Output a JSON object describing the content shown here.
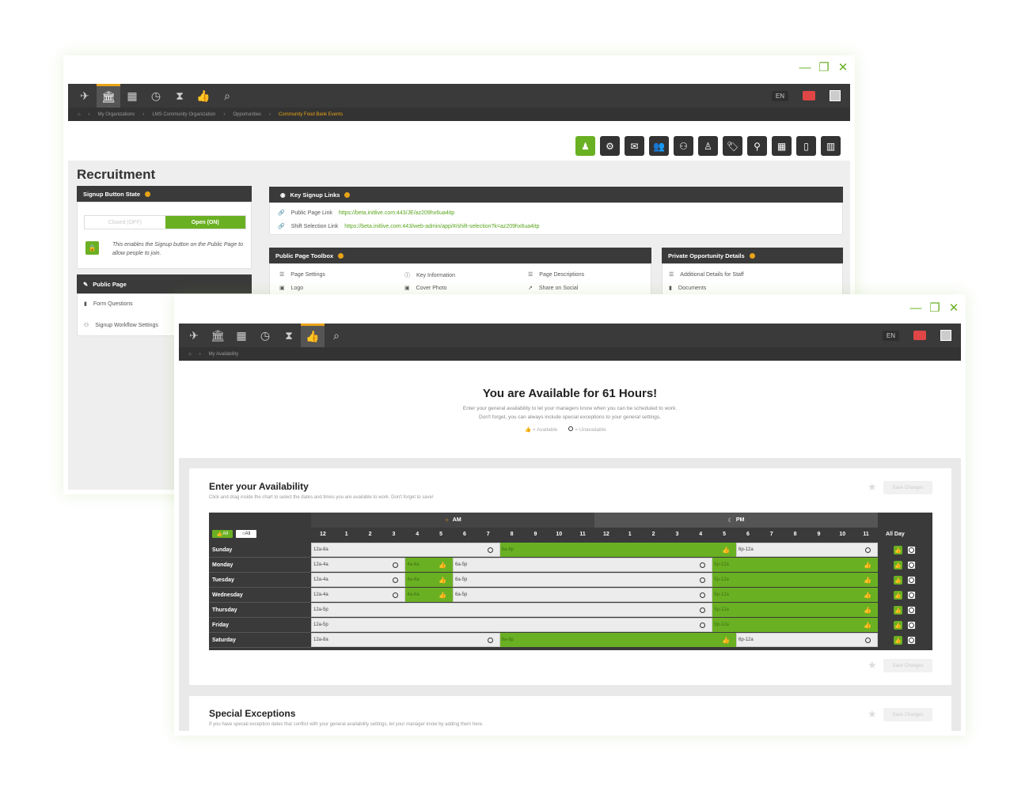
{
  "window1": {
    "page_title": "Recruitment",
    "lang": "EN",
    "breadcrumbs": [
      "My Organizations",
      "LMS Community Organization",
      "Opportunities",
      "Community Food Bank Events"
    ],
    "signup_state": {
      "title": "Signup Button State",
      "closed_label": "Closed (OFF)",
      "open_label": "Open (ON)",
      "description": "This enables the Signup button on the Public Page to allow people to join."
    },
    "key_links": {
      "title": "Key Signup Links",
      "public_label": "Public Page Link",
      "public_url": "https://beta.initlive.com:443/JE/az209hx6ua4itp",
      "shift_label": "Shift Selection Link",
      "shift_url": "https://beta.initlive.com:443/web-admin/app/#/shift-selection?k=az209hx6ua4itp"
    },
    "toolbox": {
      "title": "Public Page Toolbox",
      "items": [
        "Page Settings",
        "Key Information",
        "Page Descriptions",
        "Logo",
        "Cover Photo",
        "Share on Social"
      ]
    },
    "private": {
      "title": "Private Opportunity Details",
      "items": [
        "Additional Details for Staff",
        "Documents"
      ]
    },
    "public_page": {
      "title": "Public Page",
      "items": [
        "Form Questions",
        "Signup Workflow Settings"
      ]
    }
  },
  "window2": {
    "lang": "EN",
    "breadcrumb": "My Availability",
    "hero": {
      "title": "You are Available for 61 Hours!",
      "line1": "Enter your general availability to let your managers know when you can be scheduled to work.",
      "line2": "Don't forget, you can always include special exceptions to your general settings.",
      "legend_available": "= Available",
      "legend_unavailable": "= Unavailable"
    },
    "availability": {
      "title": "Enter your Availability",
      "subtitle": "Click and drag inside the chart to select the dates and times you are available to work. Don't forget to save!",
      "save_label": "Save Changes",
      "am_label": "AM",
      "pm_label": "PM",
      "all_label": "All",
      "allday_label": "All Day",
      "hours": [
        "12",
        "1",
        "2",
        "3",
        "4",
        "5",
        "6",
        "7",
        "8",
        "9",
        "10",
        "11",
        "12",
        "1",
        "2",
        "3",
        "4",
        "5",
        "6",
        "7",
        "8",
        "9",
        "10",
        "11"
      ],
      "days": [
        {
          "name": "Sunday",
          "segments": [
            {
              "label": "12a-8a",
              "state": "unavailable"
            },
            {
              "label": "8a-6p",
              "state": "available"
            },
            {
              "label": "6p-12a",
              "state": "unavailable"
            }
          ]
        },
        {
          "name": "Monday",
          "segments": [
            {
              "label": "12a-4a",
              "state": "unavailable"
            },
            {
              "label": "4a-6a",
              "state": "available"
            },
            {
              "label": "6a-5p",
              "state": "unavailable"
            },
            {
              "label": "5p-12a",
              "state": "available"
            }
          ]
        },
        {
          "name": "Tuesday",
          "segments": [
            {
              "label": "12a-4a",
              "state": "unavailable"
            },
            {
              "label": "4a-6a",
              "state": "available"
            },
            {
              "label": "6a-5p",
              "state": "unavailable"
            },
            {
              "label": "5p-12a",
              "state": "available"
            }
          ]
        },
        {
          "name": "Wednesday",
          "segments": [
            {
              "label": "12a-4a",
              "state": "unavailable"
            },
            {
              "label": "4a-6a",
              "state": "available"
            },
            {
              "label": "6a-5p",
              "state": "unavailable"
            },
            {
              "label": "5p-12a",
              "state": "available"
            }
          ]
        },
        {
          "name": "Thursday",
          "segments": [
            {
              "label": "12a-5p",
              "state": "unavailable"
            },
            {
              "label": "5p-12a",
              "state": "available"
            }
          ]
        },
        {
          "name": "Friday",
          "segments": [
            {
              "label": "12a-5p",
              "state": "unavailable"
            },
            {
              "label": "5p-12a",
              "state": "available"
            }
          ]
        },
        {
          "name": "Saturday",
          "segments": [
            {
              "label": "12a-8a",
              "state": "unavailable"
            },
            {
              "label": "8a-6p",
              "state": "available"
            },
            {
              "label": "6p-12a",
              "state": "unavailable"
            }
          ]
        }
      ]
    },
    "exceptions": {
      "title": "Special Exceptions",
      "subtitle": "If you have special exception dates that conflict with your general availability settings, let your manager know by adding them here.",
      "save_label": "Save Changes"
    }
  },
  "colors": {
    "accent_green": "#6ab023",
    "dark_bar": "#3a3a3a",
    "highlight": "#e8a317"
  }
}
